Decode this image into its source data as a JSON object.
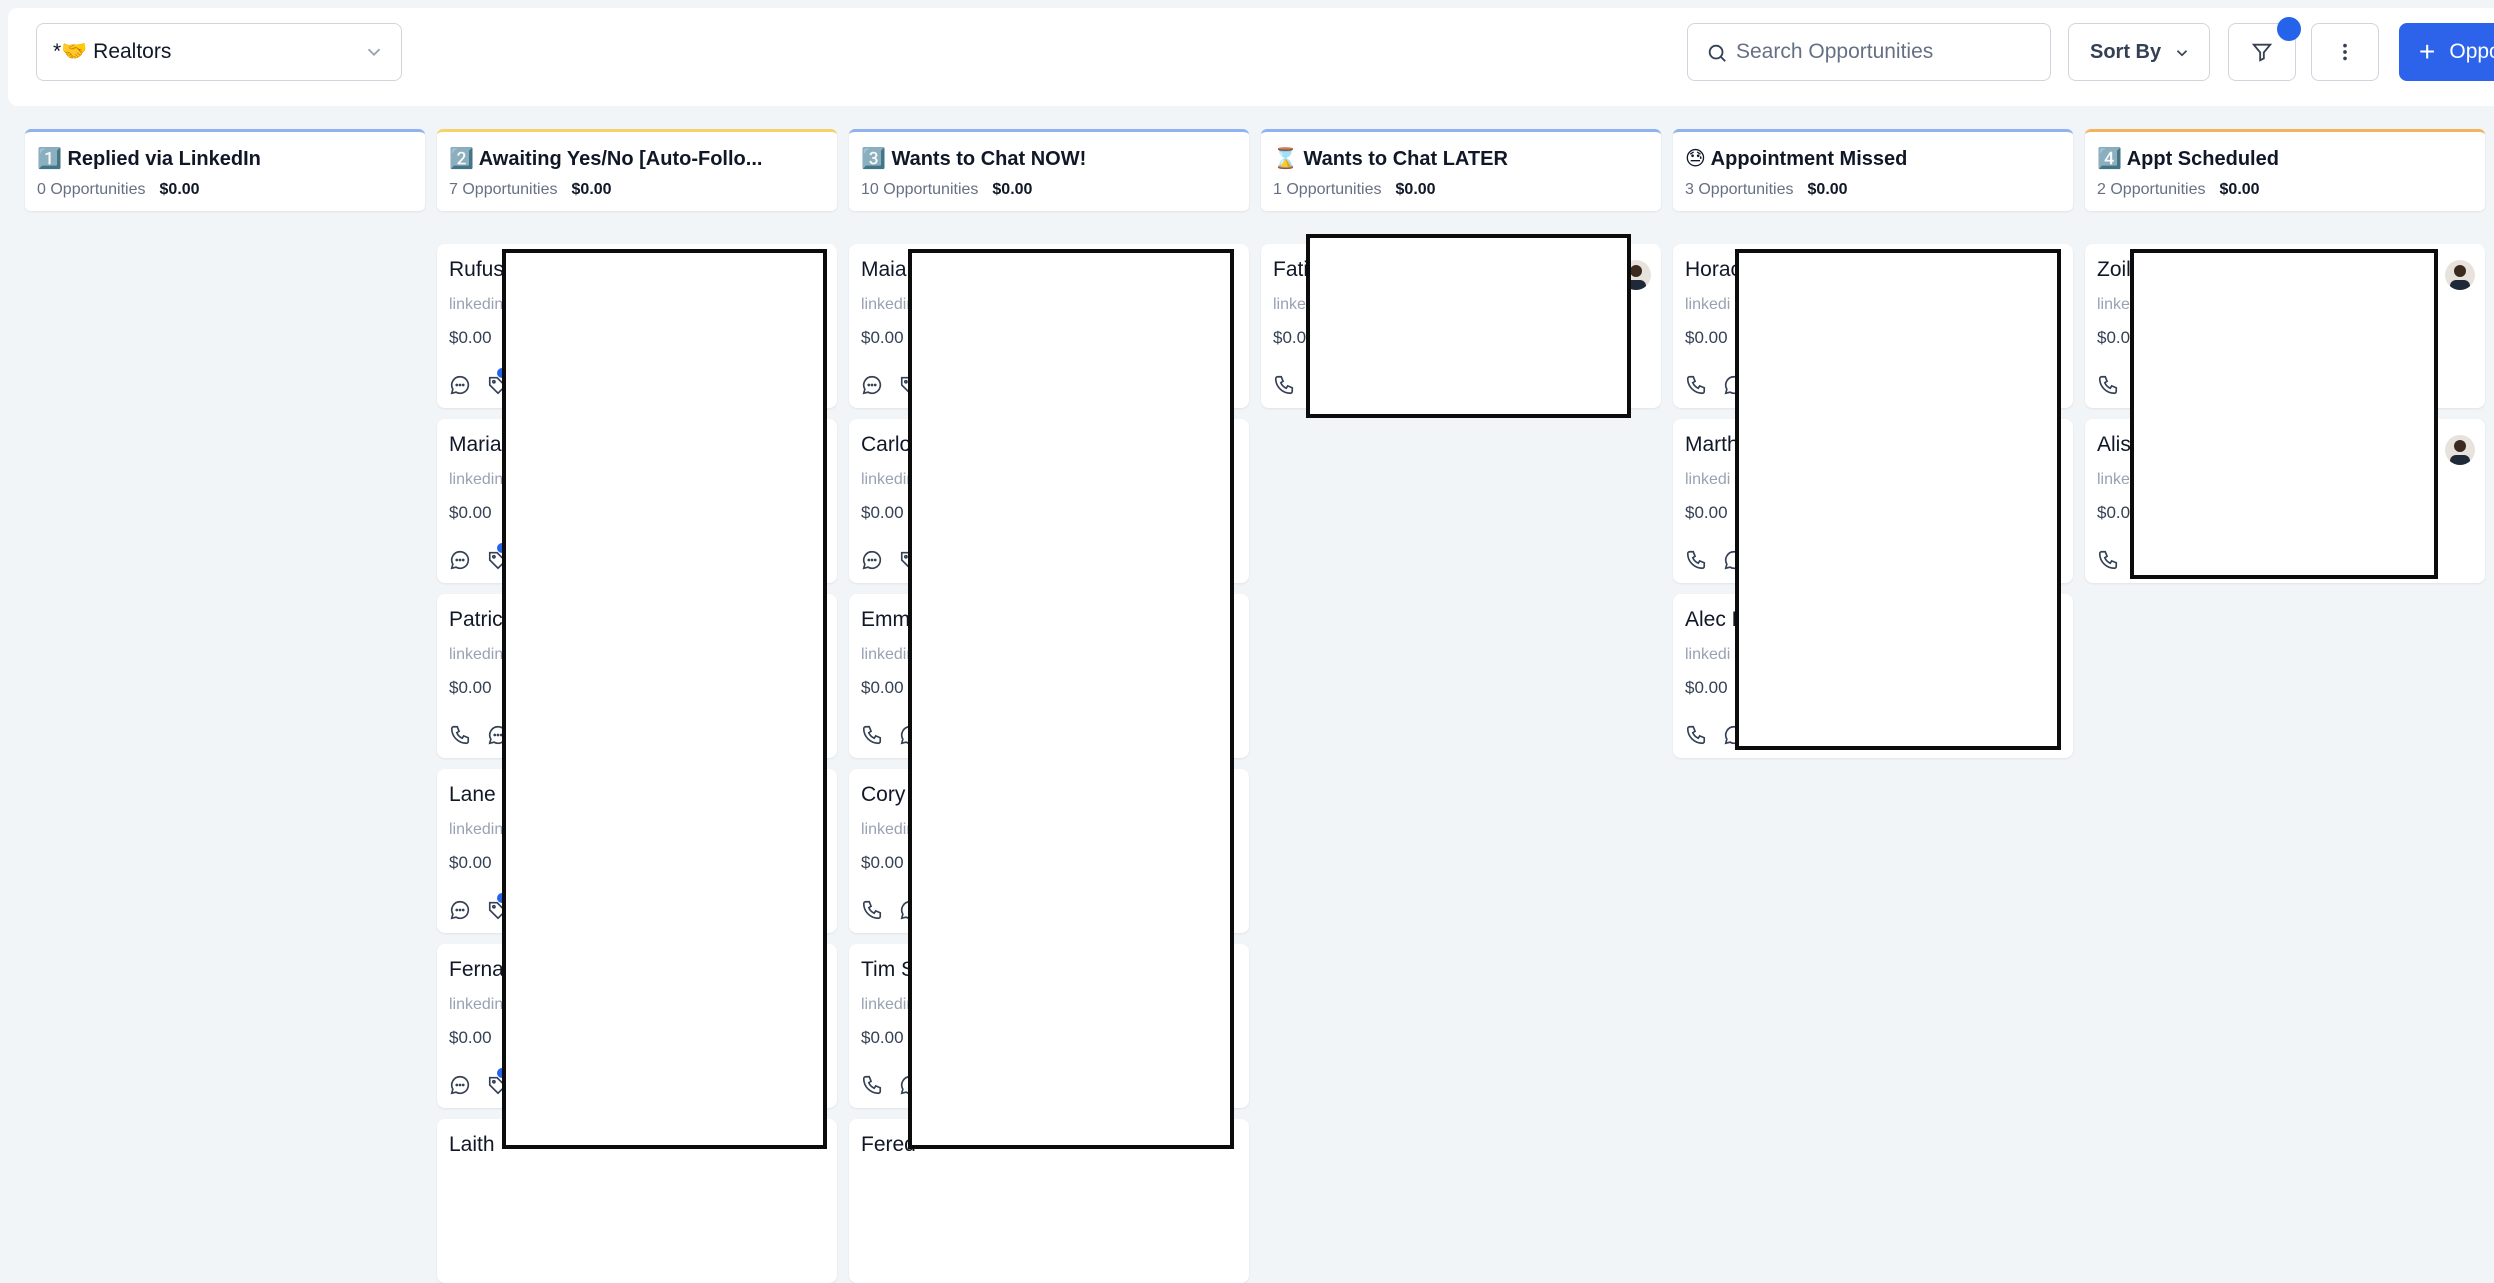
{
  "toolbar": {
    "pipeline_label": "*🤝 Realtors",
    "search_placeholder": "Search Opportunities",
    "sort_label": "Sort By",
    "add_label": "Opportunity",
    "accent_color": "#2d63eb"
  },
  "columns": [
    {
      "title": "1️⃣ Replied via LinkedIn",
      "count": "0 Opportunities",
      "amount": "$0.00"
    },
    {
      "title": "2️⃣ Awaiting Yes/No [Auto-Follo...",
      "count": "7 Opportunities",
      "amount": "$0.00"
    },
    {
      "title": "3️⃣ Wants to Chat NOW!",
      "count": "10 Opportunities",
      "amount": "$0.00"
    },
    {
      "title": "⌛ Wants to Chat LATER",
      "count": "1 Opportunities",
      "amount": "$0.00"
    },
    {
      "title": "😓 Appointment Missed",
      "count": "3 Opportunities",
      "amount": "$0.00"
    },
    {
      "title": "4️⃣ Appt Scheduled",
      "count": "2 Opportunities",
      "amount": "$0.00"
    }
  ],
  "cards": {
    "col2": [
      {
        "name": "Rufus",
        "source": "linkedin",
        "value": "$0.00"
      },
      {
        "name": "Maria",
        "source": "linkedin",
        "value": "$0.00"
      },
      {
        "name": "Patric",
        "source": "linkedin",
        "value": "$0.00"
      },
      {
        "name": "Lane I",
        "source": "linkedin",
        "value": "$0.00"
      },
      {
        "name": "Ferna",
        "source": "linkedin",
        "value": "$0.00"
      },
      {
        "name": "Laith",
        "source": "",
        "value": ""
      }
    ],
    "col3": [
      {
        "name": "Maia",
        "source": "linkedin",
        "value": "$0.00"
      },
      {
        "name": "Carlo",
        "source": "linkedin",
        "value": "$0.00"
      },
      {
        "name": "Emma",
        "source": "linkedin",
        "value": "$0.00"
      },
      {
        "name": "Cory",
        "source": "linkedin",
        "value": "$0.00"
      },
      {
        "name": "Tim S",
        "source": "linkedin",
        "value": "$0.00"
      },
      {
        "name": "Fered",
        "source": "",
        "value": ""
      }
    ],
    "col4": [
      {
        "name": "Fati",
        "source": "linke",
        "value": "$0.0"
      }
    ],
    "col5": [
      {
        "name": "Horac",
        "source": "linkedi",
        "value": "$0.00"
      },
      {
        "name": "Marth",
        "source": "linkedi",
        "value": "$0.00"
      },
      {
        "name": "Alec E",
        "source": "linkedi",
        "value": "$0.00"
      }
    ],
    "col6": [
      {
        "name": "Zoil",
        "source": "linke",
        "value": "$0.0"
      },
      {
        "name": "Alis",
        "source": "linke",
        "value": "$0.0"
      }
    ]
  }
}
